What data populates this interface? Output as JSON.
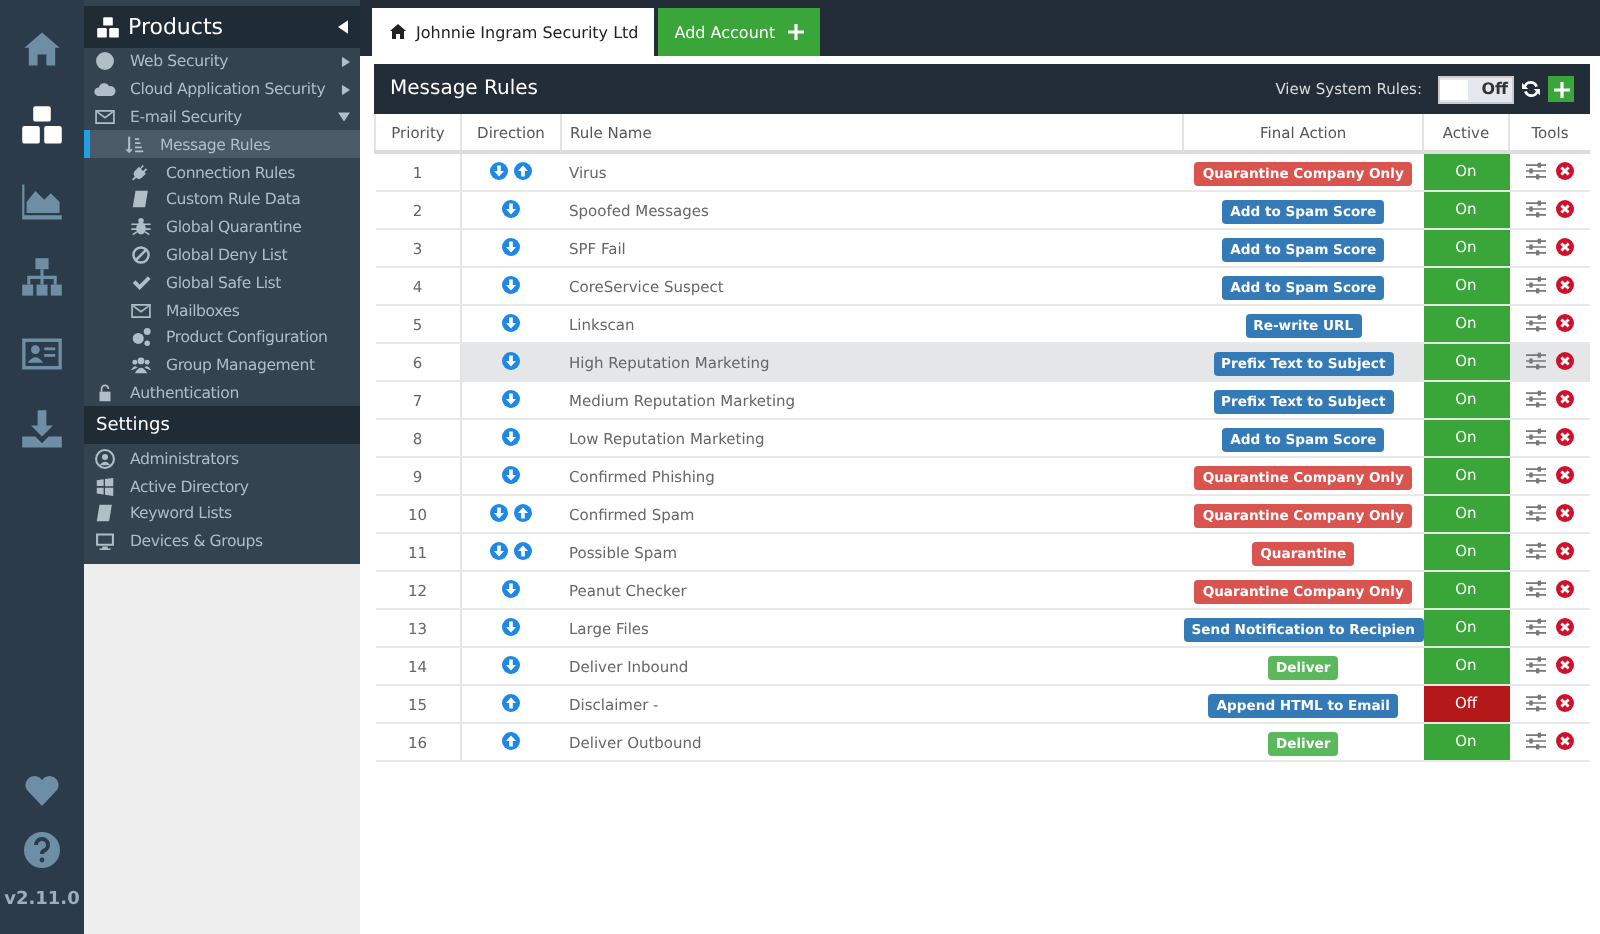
{
  "rail": {
    "items": [
      {
        "selected": false
      },
      {
        "selected": true
      },
      {
        "selected": false
      },
      {
        "selected": false
      },
      {
        "selected": false
      },
      {
        "selected": false
      }
    ],
    "version": "v2.11.0"
  },
  "sidebar": {
    "sections": [
      {
        "title": "Products",
        "items": [
          {
            "label": "Web Security",
            "expanded": false
          },
          {
            "label": "Cloud Application Security",
            "expanded": false
          },
          {
            "label": "E-mail Security",
            "expanded": true,
            "children": [
              {
                "label": "Message Rules",
                "selected": true
              },
              {
                "label": "Connection Rules",
                "selected": false
              },
              {
                "label": "Custom Rule Data",
                "selected": false
              },
              {
                "label": "Global Quarantine",
                "selected": false
              },
              {
                "label": "Global Deny List",
                "selected": false
              },
              {
                "label": "Global Safe List",
                "selected": false
              },
              {
                "label": "Mailboxes",
                "selected": false
              },
              {
                "label": "Product Configuration",
                "selected": false
              },
              {
                "label": "Group Management",
                "selected": false
              }
            ]
          },
          {
            "label": "Authentication"
          }
        ]
      },
      {
        "title": "Settings",
        "items": [
          {
            "label": "Administrators"
          },
          {
            "label": "Active Directory"
          },
          {
            "label": "Keyword Lists"
          },
          {
            "label": "Devices & Groups"
          }
        ]
      }
    ]
  },
  "tabs": [
    {
      "label": "Johnnie Ingram Security Ltd",
      "selected": true
    }
  ],
  "add_account": "Add Account",
  "panel": {
    "title": "Message Rules",
    "system_rules_label": "View System Rules:",
    "system_rules_toggle": {
      "label": "Off",
      "on": false
    }
  },
  "table": {
    "columns": [
      "Priority",
      "Direction",
      "Rule Name",
      "Final Action",
      "Active",
      "Tools"
    ],
    "rows": [
      {
        "priority": "1",
        "inbound": true,
        "outbound": true,
        "name": "Virus",
        "action": {
          "label": "Quarantine Company Only",
          "color": "#d9534f"
        },
        "active": true,
        "active_label": "On",
        "selected": false
      },
      {
        "priority": "2",
        "inbound": true,
        "outbound": false,
        "name": "Spoofed Messages",
        "action": {
          "label": "Add to Spam Score",
          "color": "#337ab7"
        },
        "active": true,
        "active_label": "On",
        "selected": false
      },
      {
        "priority": "3",
        "inbound": true,
        "outbound": false,
        "name": "SPF Fail",
        "action": {
          "label": "Add to Spam Score",
          "color": "#337ab7"
        },
        "active": true,
        "active_label": "On",
        "selected": false
      },
      {
        "priority": "4",
        "inbound": true,
        "outbound": false,
        "name": "CoreService Suspect",
        "action": {
          "label": "Add to Spam Score",
          "color": "#337ab7"
        },
        "active": true,
        "active_label": "On",
        "selected": false
      },
      {
        "priority": "5",
        "inbound": true,
        "outbound": false,
        "name": "Linkscan",
        "action": {
          "label": "Re-write URL",
          "color": "#337ab7"
        },
        "active": true,
        "active_label": "On",
        "selected": false
      },
      {
        "priority": "6",
        "inbound": true,
        "outbound": false,
        "name": "High Reputation Marketing",
        "action": {
          "label": "Prefix Text to Subject",
          "color": "#337ab7"
        },
        "active": true,
        "active_label": "On",
        "selected": true
      },
      {
        "priority": "7",
        "inbound": true,
        "outbound": false,
        "name": "Medium Reputation Marketing",
        "action": {
          "label": "Prefix Text to Subject",
          "color": "#337ab7"
        },
        "active": true,
        "active_label": "On",
        "selected": false
      },
      {
        "priority": "8",
        "inbound": true,
        "outbound": false,
        "name": "Low Reputation Marketing",
        "action": {
          "label": "Add to Spam Score",
          "color": "#337ab7"
        },
        "active": true,
        "active_label": "On",
        "selected": false
      },
      {
        "priority": "9",
        "inbound": true,
        "outbound": false,
        "name": "Confirmed Phishing",
        "action": {
          "label": "Quarantine Company Only",
          "color": "#d9534f"
        },
        "active": true,
        "active_label": "On",
        "selected": false
      },
      {
        "priority": "10",
        "inbound": true,
        "outbound": true,
        "name": "Confirmed Spam",
        "action": {
          "label": "Quarantine Company Only",
          "color": "#d9534f"
        },
        "active": true,
        "active_label": "On",
        "selected": false
      },
      {
        "priority": "11",
        "inbound": true,
        "outbound": true,
        "name": "Possible Spam",
        "action": {
          "label": "Quarantine",
          "color": "#d9534f"
        },
        "active": true,
        "active_label": "On",
        "selected": false
      },
      {
        "priority": "12",
        "inbound": true,
        "outbound": false,
        "name": "Peanut Checker",
        "action": {
          "label": "Quarantine Company Only",
          "color": "#d9534f"
        },
        "active": true,
        "active_label": "On",
        "selected": false
      },
      {
        "priority": "13",
        "inbound": true,
        "outbound": false,
        "name": "Large Files",
        "action": {
          "label": "Send Notification to Recipien",
          "color": "#337ab7"
        },
        "active": true,
        "active_label": "On",
        "selected": false
      },
      {
        "priority": "14",
        "inbound": true,
        "outbound": false,
        "name": "Deliver Inbound",
        "action": {
          "label": "Deliver",
          "color": "#5cb85c"
        },
        "active": true,
        "active_label": "On",
        "selected": false
      },
      {
        "priority": "15",
        "inbound": false,
        "outbound": true,
        "name": "Disclaimer -",
        "action": {
          "label": "Append HTML to Email",
          "color": "#337ab7"
        },
        "active": false,
        "active_label": "Off",
        "selected": false
      },
      {
        "priority": "16",
        "inbound": false,
        "outbound": true,
        "name": "Deliver Outbound",
        "action": {
          "label": "Deliver",
          "color": "#5cb85c"
        },
        "active": true,
        "active_label": "On",
        "selected": false
      }
    ]
  }
}
